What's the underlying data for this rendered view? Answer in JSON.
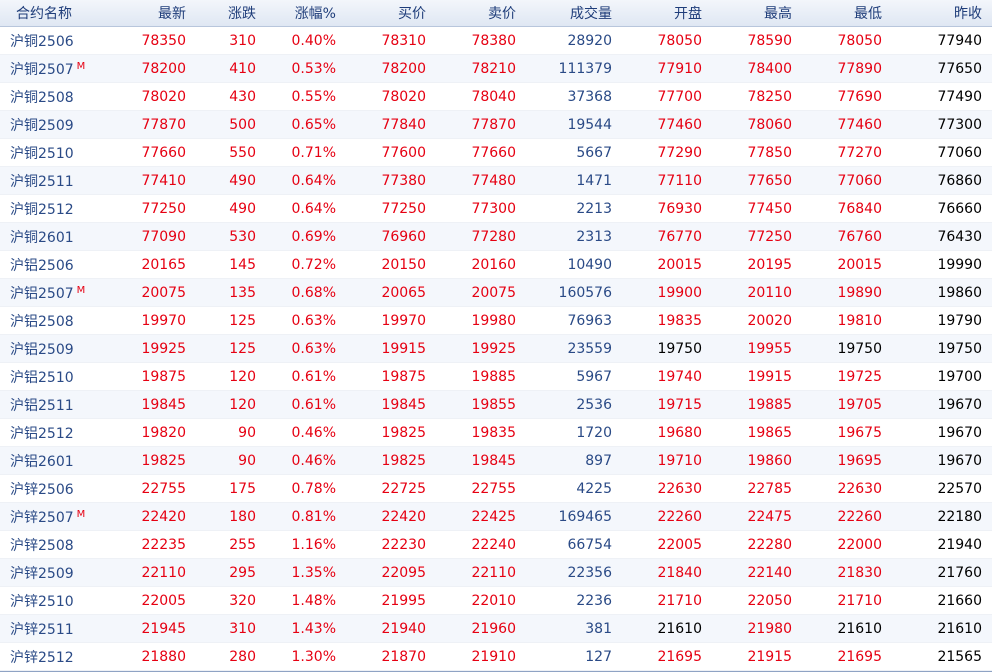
{
  "columns": [
    "合约名称",
    "最新",
    "涨跌",
    "涨幅%",
    "买价",
    "卖价",
    "成交量",
    "开盘",
    "最高",
    "最低",
    "昨收"
  ],
  "colors": {
    "up": "#e60012",
    "down": "#008a00",
    "volume": "#2a4a86",
    "flat": "#000000"
  },
  "rows": [
    {
      "name": "沪铜2506",
      "flag": "",
      "last": "78350",
      "change": "310",
      "pct": "0.40%",
      "bid": "78310",
      "ask": "78380",
      "volume": "28920",
      "open": "78050",
      "high": "78590",
      "low": "78050",
      "prev": "77940"
    },
    {
      "name": "沪铜2507",
      "flag": "M",
      "last": "78200",
      "change": "410",
      "pct": "0.53%",
      "bid": "78200",
      "ask": "78210",
      "volume": "111379",
      "open": "77910",
      "high": "78400",
      "low": "77890",
      "prev": "77650"
    },
    {
      "name": "沪铜2508",
      "flag": "",
      "last": "78020",
      "change": "430",
      "pct": "0.55%",
      "bid": "78020",
      "ask": "78040",
      "volume": "37368",
      "open": "77700",
      "high": "78250",
      "low": "77690",
      "prev": "77490"
    },
    {
      "name": "沪铜2509",
      "flag": "",
      "last": "77870",
      "change": "500",
      "pct": "0.65%",
      "bid": "77840",
      "ask": "77870",
      "volume": "19544",
      "open": "77460",
      "high": "78060",
      "low": "77460",
      "prev": "77300"
    },
    {
      "name": "沪铜2510",
      "flag": "",
      "last": "77660",
      "change": "550",
      "pct": "0.71%",
      "bid": "77600",
      "ask": "77660",
      "volume": "5667",
      "open": "77290",
      "high": "77850",
      "low": "77270",
      "prev": "77060"
    },
    {
      "name": "沪铜2511",
      "flag": "",
      "last": "77410",
      "change": "490",
      "pct": "0.64%",
      "bid": "77380",
      "ask": "77480",
      "volume": "1471",
      "open": "77110",
      "high": "77650",
      "low": "77060",
      "prev": "76860"
    },
    {
      "name": "沪铜2512",
      "flag": "",
      "last": "77250",
      "change": "490",
      "pct": "0.64%",
      "bid": "77250",
      "ask": "77300",
      "volume": "2213",
      "open": "76930",
      "high": "77450",
      "low": "76840",
      "prev": "76660"
    },
    {
      "name": "沪铜2601",
      "flag": "",
      "last": "77090",
      "change": "530",
      "pct": "0.69%",
      "bid": "76960",
      "ask": "77280",
      "volume": "2313",
      "open": "76770",
      "high": "77250",
      "low": "76760",
      "prev": "76430"
    },
    {
      "name": "沪铝2506",
      "flag": "",
      "last": "20165",
      "change": "145",
      "pct": "0.72%",
      "bid": "20150",
      "ask": "20160",
      "volume": "10490",
      "open": "20015",
      "high": "20195",
      "low": "20015",
      "prev": "19990"
    },
    {
      "name": "沪铝2507",
      "flag": "M",
      "last": "20075",
      "change": "135",
      "pct": "0.68%",
      "bid": "20065",
      "ask": "20075",
      "volume": "160576",
      "open": "19900",
      "high": "20110",
      "low": "19890",
      "prev": "19860"
    },
    {
      "name": "沪铝2508",
      "flag": "",
      "last": "19970",
      "change": "125",
      "pct": "0.63%",
      "bid": "19970",
      "ask": "19980",
      "volume": "76963",
      "open": "19835",
      "high": "20020",
      "low": "19810",
      "prev": "19790"
    },
    {
      "name": "沪铝2509",
      "flag": "",
      "last": "19925",
      "change": "125",
      "pct": "0.63%",
      "bid": "19915",
      "ask": "19925",
      "volume": "23559",
      "open": "19750",
      "high": "19955",
      "low": "19750",
      "prev": "19750"
    },
    {
      "name": "沪铝2510",
      "flag": "",
      "last": "19875",
      "change": "120",
      "pct": "0.61%",
      "bid": "19875",
      "ask": "19885",
      "volume": "5967",
      "open": "19740",
      "high": "19915",
      "low": "19725",
      "prev": "19700"
    },
    {
      "name": "沪铝2511",
      "flag": "",
      "last": "19845",
      "change": "120",
      "pct": "0.61%",
      "bid": "19845",
      "ask": "19855",
      "volume": "2536",
      "open": "19715",
      "high": "19885",
      "low": "19705",
      "prev": "19670"
    },
    {
      "name": "沪铝2512",
      "flag": "",
      "last": "19820",
      "change": "90",
      "pct": "0.46%",
      "bid": "19825",
      "ask": "19835",
      "volume": "1720",
      "open": "19680",
      "high": "19865",
      "low": "19675",
      "prev": "19670"
    },
    {
      "name": "沪铝2601",
      "flag": "",
      "last": "19825",
      "change": "90",
      "pct": "0.46%",
      "bid": "19825",
      "ask": "19845",
      "volume": "897",
      "open": "19710",
      "high": "19860",
      "low": "19695",
      "prev": "19670"
    },
    {
      "name": "沪锌2506",
      "flag": "",
      "last": "22755",
      "change": "175",
      "pct": "0.78%",
      "bid": "22725",
      "ask": "22755",
      "volume": "4225",
      "open": "22630",
      "high": "22785",
      "low": "22630",
      "prev": "22570"
    },
    {
      "name": "沪锌2507",
      "flag": "M",
      "last": "22420",
      "change": "180",
      "pct": "0.81%",
      "bid": "22420",
      "ask": "22425",
      "volume": "169465",
      "open": "22260",
      "high": "22475",
      "low": "22260",
      "prev": "22180"
    },
    {
      "name": "沪锌2508",
      "flag": "",
      "last": "22235",
      "change": "255",
      "pct": "1.16%",
      "bid": "22230",
      "ask": "22240",
      "volume": "66754",
      "open": "22005",
      "high": "22280",
      "low": "22000",
      "prev": "21940"
    },
    {
      "name": "沪锌2509",
      "flag": "",
      "last": "22110",
      "change": "295",
      "pct": "1.35%",
      "bid": "22095",
      "ask": "22110",
      "volume": "22356",
      "open": "21840",
      "high": "22140",
      "low": "21830",
      "prev": "21760"
    },
    {
      "name": "沪锌2510",
      "flag": "",
      "last": "22005",
      "change": "320",
      "pct": "1.48%",
      "bid": "21995",
      "ask": "22010",
      "volume": "2236",
      "open": "21710",
      "high": "22050",
      "low": "21710",
      "prev": "21660"
    },
    {
      "name": "沪锌2511",
      "flag": "",
      "last": "21945",
      "change": "310",
      "pct": "1.43%",
      "bid": "21940",
      "ask": "21960",
      "volume": "381",
      "open": "21610",
      "high": "21980",
      "low": "21610",
      "prev": "21610"
    },
    {
      "name": "沪锌2512",
      "flag": "",
      "last": "21880",
      "change": "280",
      "pct": "1.30%",
      "bid": "21870",
      "ask": "21910",
      "volume": "127",
      "open": "21695",
      "high": "21915",
      "low": "21695",
      "prev": "21565"
    }
  ]
}
